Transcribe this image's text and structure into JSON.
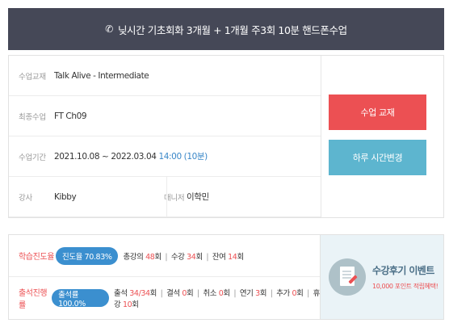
{
  "header": {
    "title": "닞시간 기초회화 3개월 + 1개월 주3회 10분 핸드폰수업"
  },
  "info": {
    "course_label": "수업교재",
    "course_value": "Talk Alive - Intermediate",
    "final_label": "최종수업",
    "final_value": "FT Ch09",
    "period_label": "수업기간",
    "period_value": "2021.10.08 ~ 2022.03.04",
    "period_time": "14:00 (10분)",
    "teacher_label": "강사",
    "teacher_value": "Kibby",
    "manager_label": "매니저",
    "manager_value": "이학민"
  },
  "buttons": {
    "change_book": "수업 교재",
    "change_time": "하루 시간변경"
  },
  "progress": {
    "study_label": "학습진도율",
    "study_pill": "진도율 70.83%",
    "study_stats": {
      "total_label": "총강의",
      "total_value": "48",
      "total_unit": "회",
      "done_label": "수강",
      "done_value": "34",
      "done_unit": "회",
      "left_label": "잔여",
      "left_value": "14",
      "left_unit": "회"
    },
    "attend_label": "출석진행률",
    "attend_pill": "출석률 100.0%",
    "attend_stats": {
      "attend_label": "출석",
      "attend_value": "34/34",
      "attend_unit": "회",
      "absent_label": "결석",
      "absent_value": "0",
      "absent_unit": "회",
      "cancel_label": "취소",
      "cancel_value": "0",
      "cancel_unit": "회",
      "delay_label": "연기",
      "delay_value": "3",
      "delay_unit": "회",
      "extra_label": "추가",
      "extra_value": "0",
      "extra_unit": "회",
      "break_label": "휴강",
      "break_value": "10",
      "break_unit": "회"
    }
  },
  "event": {
    "title": "수강후기 이벤트",
    "subtitle": "10,000 포인트 적립혜택!"
  },
  "colors": {
    "header_bg": "#454857",
    "accent_red": "#ec5053",
    "accent_teal": "#5db5cf",
    "pill_blue": "#3b8fcf"
  }
}
